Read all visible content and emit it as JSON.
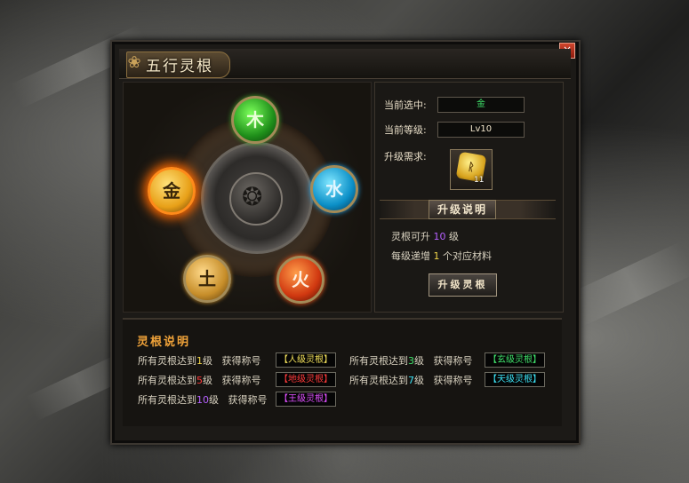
{
  "window": {
    "title": "五行灵根",
    "close_label": "×"
  },
  "elements": {
    "wood": "木",
    "water": "水",
    "fire": "火",
    "earth": "土",
    "metal": "金"
  },
  "info": {
    "selected_label": "当前选中:",
    "selected_value": "金",
    "level_label": "当前等级:",
    "level_value": "Lv10",
    "requirement_label": "升级需求:",
    "item_count": "11"
  },
  "upgrade_desc": {
    "header": "升级说明",
    "line1_prefix": "灵根可升",
    "line1_num": "10",
    "line1_suffix": "级",
    "line2_prefix": "每级递增",
    "line2_num": "1",
    "line2_suffix": "个对应材料"
  },
  "upgrade_button": "升级灵根",
  "spirit_root": {
    "title": "灵根说明",
    "rows": [
      {
        "prefix": "所有灵根达到",
        "level": "1",
        "unit": "级",
        "reward_label": "获得称号",
        "title": "【人级灵根】",
        "color": "#f2e05a",
        "level_color": "#f2d64a"
      },
      {
        "prefix": "所有灵根达到",
        "level": "3",
        "unit": "级",
        "reward_label": "获得称号",
        "title": "【玄级灵根】",
        "color": "#3fe06a",
        "level_color": "#3fe06a"
      },
      {
        "prefix": "所有灵根达到",
        "level": "5",
        "unit": "级",
        "reward_label": "获得称号",
        "title": "【地级灵根】",
        "color": "#ff3a3a",
        "level_color": "#ff3a3a"
      },
      {
        "prefix": "所有灵根达到",
        "level": "7",
        "unit": "级",
        "reward_label": "获得称号",
        "title": "【天级灵根】",
        "color": "#3ae0f2",
        "level_color": "#3ae0f2"
      },
      {
        "prefix": "所有灵根达到",
        "level": "10",
        "unit": "级",
        "reward_label": "获得称号",
        "title": "【王级灵根】",
        "color": "#e050ff",
        "level_color": "#b660ff"
      }
    ]
  }
}
